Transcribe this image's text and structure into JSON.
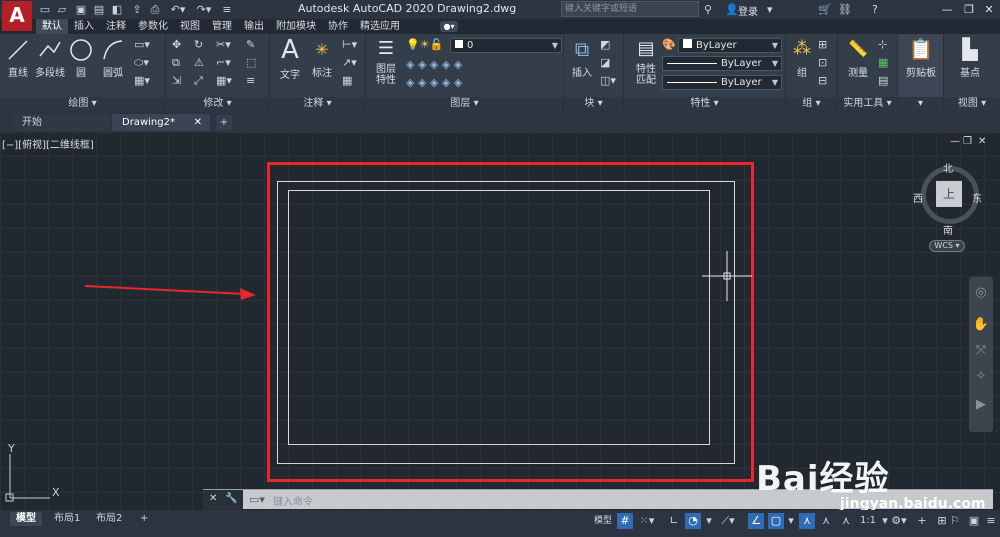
{
  "app": {
    "logo_letter": "A",
    "title": "Autodesk AutoCAD 2020    Drawing2.dwg",
    "search_placeholder": "键入关键字或短语",
    "login": "登录"
  },
  "ribbon_tabs": [
    "默认",
    "插入",
    "注释",
    "参数化",
    "视图",
    "管理",
    "输出",
    "附加模块",
    "协作",
    "精选应用"
  ],
  "active_tab": "默认",
  "panels": {
    "draw": {
      "title": "绘图",
      "tools": [
        "直线",
        "多段线",
        "圆",
        "圆弧"
      ]
    },
    "modify": {
      "title": "修改"
    },
    "annotation": {
      "title": "注释",
      "tools": [
        "文字",
        "标注"
      ]
    },
    "layers": {
      "title": "图层",
      "tool": "图层\n特性",
      "current_layer": "0"
    },
    "block": {
      "title": "块",
      "tool": "插入"
    },
    "properties": {
      "title": "特性",
      "tool": "特性\n匹配",
      "color": "ByLayer",
      "linetype": "ByLayer",
      "lineweight": "ByLayer"
    },
    "groups": {
      "title": "组",
      "tool": "组"
    },
    "utilities": {
      "title": "实用工具",
      "tool": "测量"
    },
    "clipboard": {
      "title": "剪贴板"
    },
    "view": {
      "title": "视图",
      "tool": "基点"
    }
  },
  "doc_tabs": {
    "start": "开始",
    "drawing": "Drawing2*"
  },
  "viewport": {
    "label": "[−][俯视][二维线框]"
  },
  "viewcube": {
    "north": "北",
    "south": "南",
    "east": "东",
    "west": "西",
    "face": "上",
    "wcs": "WCS"
  },
  "command": {
    "placeholder": "键入命令"
  },
  "layout_tabs": [
    "模型",
    "布局1",
    "布局2"
  ],
  "status": {
    "model": "模型",
    "scale": "1:1"
  },
  "watermark": {
    "text": "Bai经验",
    "url": "jingyan.baidu.com"
  },
  "colors": {
    "highlight_box": "#e8262b",
    "arrow": "#e8262b",
    "accent": "#2e6cb5"
  }
}
